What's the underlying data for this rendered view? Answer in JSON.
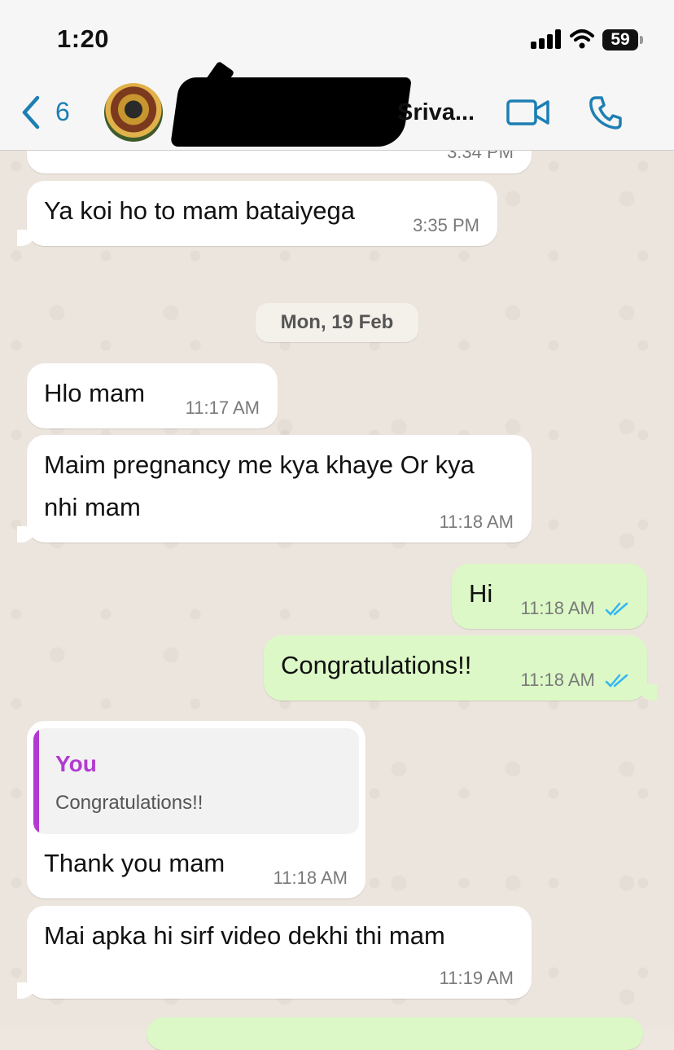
{
  "status_bar": {
    "time": "1:20",
    "battery": "59"
  },
  "header": {
    "back_count": "6",
    "contact_name": "Sriva..."
  },
  "messages": {
    "m0": {
      "time": "3:34 PM"
    },
    "m1": {
      "text": "Ya koi ho to mam bataiyega",
      "time": "3:35 PM"
    },
    "date_divider": "Mon, 19 Feb",
    "m2": {
      "text": "Hlo mam",
      "time": "11:17 AM"
    },
    "m3": {
      "line1": "Maim pregnancy me kya khaye Or kya",
      "line2": "nhi mam",
      "time": "11:18 AM"
    },
    "m4": {
      "text": "Hi",
      "time": "11:18 AM"
    },
    "m5": {
      "text": "Congratulations!!",
      "time": "11:18 AM"
    },
    "m6": {
      "quote_author": "You",
      "quote_text": "Congratulations!!",
      "text": "Thank you mam",
      "time": "11:18 AM"
    },
    "m7": {
      "text": "Mai apka hi sirf video dekhi thi mam",
      "time": "11:19 AM"
    }
  },
  "colors": {
    "accent": "#1d7fb4",
    "outgoing_bubble": "#dcf8c6",
    "incoming_bubble": "#ffffff",
    "quote_author": "#b13bd1",
    "read_ticks": "#34b7f1"
  }
}
